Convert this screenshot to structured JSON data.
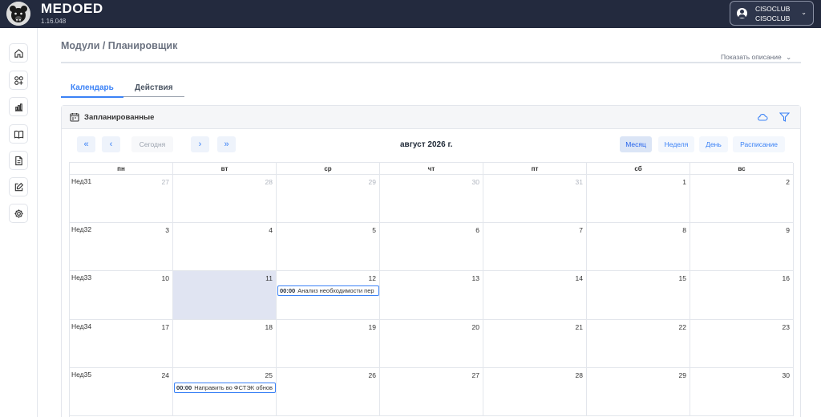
{
  "app": {
    "brand": "MEDOED",
    "version": "1.16.048"
  },
  "user": {
    "line1": "CISOCLUB",
    "line2": "CISOCLUB"
  },
  "sidebar": {
    "items": [
      {
        "icon": "home-icon"
      },
      {
        "icon": "modules-icon"
      },
      {
        "icon": "chart-icon"
      },
      {
        "icon": "book-icon"
      },
      {
        "icon": "document-icon"
      },
      {
        "icon": "edit-icon"
      },
      {
        "icon": "settings-icon"
      }
    ]
  },
  "header": {
    "title": "Модули / Планировщик",
    "show_description": "Показать описание"
  },
  "tabs": [
    {
      "label": "Календарь",
      "active": true
    },
    {
      "label": "Действия",
      "active": false
    }
  ],
  "card": {
    "title": "Запланированные"
  },
  "toolbar": {
    "first": "«",
    "prev": "‹",
    "today": "Сегодня",
    "next": "›",
    "last": "»",
    "month_title": "август 2026 г.",
    "views": [
      {
        "label": "Месяц",
        "active": true
      },
      {
        "label": "Неделя"
      },
      {
        "label": "День"
      },
      {
        "label": "Расписание"
      }
    ]
  },
  "calendar": {
    "weekdays": [
      "пн",
      "вт",
      "ср",
      "чт",
      "пт",
      "сб",
      "вс"
    ],
    "weeks": [
      {
        "label": "Нед31",
        "days": [
          {
            "d": "27",
            "other": true
          },
          {
            "d": "28",
            "other": true
          },
          {
            "d": "29",
            "other": true
          },
          {
            "d": "30",
            "other": true
          },
          {
            "d": "31",
            "other": true
          },
          {
            "d": "1"
          },
          {
            "d": "2"
          }
        ]
      },
      {
        "label": "Нед32",
        "days": [
          {
            "d": "3"
          },
          {
            "d": "4"
          },
          {
            "d": "5"
          },
          {
            "d": "6"
          },
          {
            "d": "7"
          },
          {
            "d": "8"
          },
          {
            "d": "9"
          }
        ]
      },
      {
        "label": "Нед33",
        "days": [
          {
            "d": "10"
          },
          {
            "d": "11",
            "today": true
          },
          {
            "d": "12",
            "event": {
              "time": "00:00",
              "text": "Анализ необходимости пер"
            }
          },
          {
            "d": "13"
          },
          {
            "d": "14"
          },
          {
            "d": "15"
          },
          {
            "d": "16"
          }
        ]
      },
      {
        "label": "Нед34",
        "days": [
          {
            "d": "17"
          },
          {
            "d": "18"
          },
          {
            "d": "19"
          },
          {
            "d": "20"
          },
          {
            "d": "21"
          },
          {
            "d": "22"
          },
          {
            "d": "23"
          }
        ]
      },
      {
        "label": "Нед35",
        "days": [
          {
            "d": "24"
          },
          {
            "d": "25",
            "event": {
              "time": "00:00",
              "text": "Направить во ФСТЭК обнов"
            }
          },
          {
            "d": "26"
          },
          {
            "d": "27"
          },
          {
            "d": "28"
          },
          {
            "d": "29"
          },
          {
            "d": "30"
          }
        ]
      }
    ]
  },
  "colors": {
    "topbar": "#232a3e",
    "accent": "#3b82f6",
    "today_cell": "#e0e4f2"
  }
}
